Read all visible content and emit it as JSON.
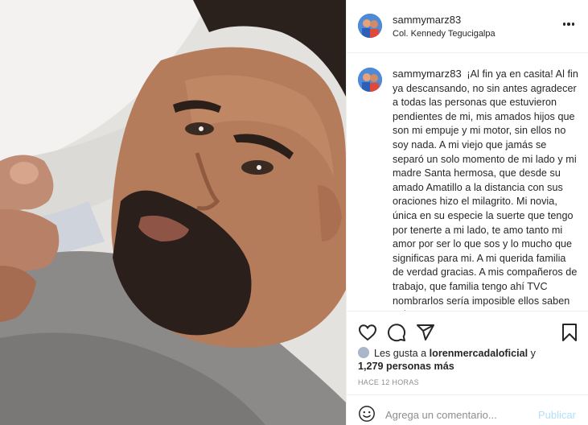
{
  "post": {
    "username": "sammymarz83",
    "location": "Col. Kennedy Tegucigalpa"
  },
  "caption": {
    "username": "sammymarz83",
    "text": "¡Al fin ya en casita! Al fin ya descansando, no sin antes agradecer a todas las personas que estuvieron pendientes de mi, mis amados hijos que son mi empuje y mi motor, sin ellos no soy nada. A mi viejo que jamás se separó un solo momento de mi lado y mi madre Santa hermosa, que desde su amado Amatillo a la distancia con sus oraciones hizo el milagrito. Mi novia, única en su especie la suerte que tengo por tenerte a mi lado, te amo tanto mi amor por ser lo que sos y lo mucho que significas para mi. A mi querida familia de verdad gracias. A mis compañeros de trabajo, que familia tengo ahí TVC nombrarlos sería imposible ellos saben quienes"
  },
  "actions": {
    "like_icon": "heart-icon",
    "comment_icon": "comment-icon",
    "share_icon": "share-icon",
    "save_icon": "bookmark-icon"
  },
  "likes": {
    "prefix": "Les gusta a",
    "user": "lorenmercadaloficial",
    "conjunction": "y",
    "count": "1,279 personas más"
  },
  "timestamp": "HACE 12 HORAS",
  "comment": {
    "placeholder": "Agrega un comentario...",
    "publish_label": "Publicar",
    "emoji_icon": "smiley-icon"
  },
  "colors": {
    "text": "#262626",
    "muted": "#8e8e8e",
    "publish_disabled": "#b2dffc",
    "divider": "#efefef"
  }
}
